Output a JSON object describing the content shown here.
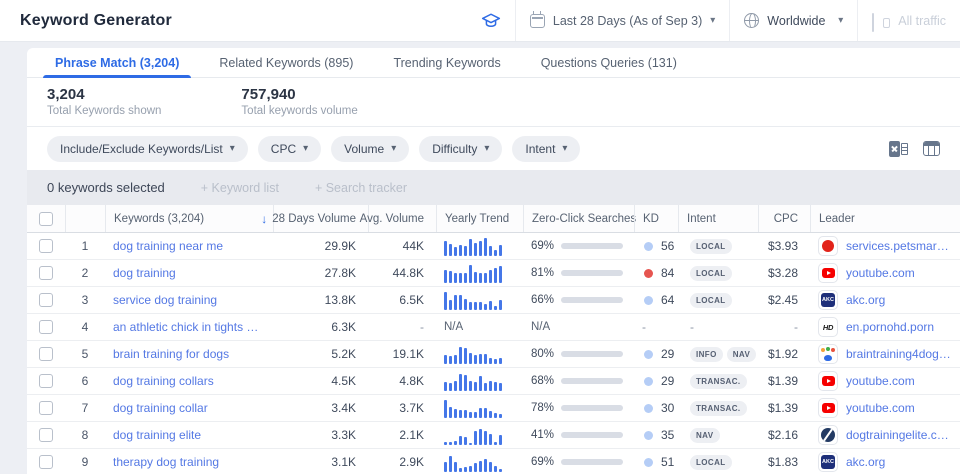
{
  "header": {
    "title": "Keyword Generator",
    "date_range": "Last 28 Days (As of Sep 3)",
    "region": "Worldwide",
    "traffic_label": "All traffic"
  },
  "tabs": [
    {
      "label": "Phrase Match (3,204)",
      "active": true
    },
    {
      "label": "Related Keywords (895)",
      "active": false
    },
    {
      "label": "Trending Keywords",
      "active": false
    },
    {
      "label": "Questions Queries (131)",
      "active": false
    }
  ],
  "stats": [
    {
      "value": "3,204",
      "label": "Total Keywords shown"
    },
    {
      "value": "757,940",
      "label": "Total keywords volume"
    }
  ],
  "filters": [
    "Include/Exclude Keywords/List",
    "CPC",
    "Volume",
    "Difficulty",
    "Intent"
  ],
  "toolbar_icons": [
    "excel-export-icon",
    "table-columns-icon"
  ],
  "selection": {
    "selected_text": "0 keywords selected",
    "keyword_list_label": "+ Keyword list",
    "search_tracker_label": "+ Search tracker"
  },
  "table": {
    "columns": [
      {
        "label": "Keywords (3,204)",
        "sorted": false,
        "align": "left"
      },
      {
        "label": "28 Days Volume",
        "sorted": true,
        "align": "right"
      },
      {
        "label": "Avg. Volume",
        "sorted": false,
        "align": "right"
      },
      {
        "label": "Yearly Trend",
        "sorted": false,
        "align": "left"
      },
      {
        "label": "Zero-Click Searches",
        "sorted": false,
        "align": "left"
      },
      {
        "label": "KD",
        "sorted": false,
        "align": "left"
      },
      {
        "label": "Intent",
        "sorted": false,
        "align": "left"
      },
      {
        "label": "CPC",
        "sorted": false,
        "align": "right"
      },
      {
        "label": "Leader",
        "sorted": false,
        "align": "left"
      }
    ],
    "rows": [
      {
        "num": "1",
        "keyword": "dog training near me",
        "volume_28d": "29.9K",
        "avg_volume": "44K",
        "trend": [
          80,
          65,
          45,
          60,
          55,
          92,
          70,
          80,
          95,
          55,
          30,
          60
        ],
        "zero_click": "69%",
        "zero_click_pct": 69,
        "kd": "56",
        "kd_color": "blue",
        "intents": [
          "LOCAL"
        ],
        "cpc": "$3.93",
        "leader": "services.petsmart…",
        "favicon": "petsmart"
      },
      {
        "num": "2",
        "keyword": "dog training",
        "volume_28d": "27.8K",
        "avg_volume": "44.8K",
        "trend": [
          70,
          62,
          50,
          50,
          55,
          95,
          60,
          50,
          52,
          70,
          80,
          88
        ],
        "zero_click": "81%",
        "zero_click_pct": 81,
        "kd": "84",
        "kd_color": "red",
        "intents": [
          "LOCAL"
        ],
        "cpc": "$3.28",
        "leader": "youtube.com",
        "favicon": "youtube"
      },
      {
        "num": "3",
        "keyword": "service dog training",
        "volume_28d": "13.8K",
        "avg_volume": "6.5K",
        "trend": [
          95,
          50,
          80,
          78,
          60,
          40,
          42,
          40,
          30,
          45,
          20,
          52
        ],
        "zero_click": "66%",
        "zero_click_pct": 66,
        "kd": "64",
        "kd_color": "blue",
        "intents": [
          "LOCAL"
        ],
        "cpc": "$2.45",
        "leader": "akc.org",
        "favicon": "akc"
      },
      {
        "num": "4",
        "keyword": "an athletic chick in tights got up d…",
        "volume_28d": "6.3K",
        "avg_volume": "-",
        "trend": null,
        "zero_click": "N/A",
        "zero_click_pct": null,
        "kd": "-",
        "kd_color": null,
        "intents": [],
        "cpc": "-",
        "leader": "en.pornohd.porn",
        "favicon": "hd"
      },
      {
        "num": "5",
        "keyword": "brain training for dogs",
        "volume_28d": "5.2K",
        "avg_volume": "19.1K",
        "trend": [
          48,
          40,
          45,
          90,
          85,
          60,
          45,
          55,
          50,
          30,
          28,
          30
        ],
        "zero_click": "80%",
        "zero_click_pct": 80,
        "kd": "29",
        "kd_color": "blue",
        "intents": [
          "INFO",
          "NAV"
        ],
        "cpc": "$1.92",
        "leader": "braintraining4dog…",
        "favicon": "paw"
      },
      {
        "num": "6",
        "keyword": "dog training collars",
        "volume_28d": "4.5K",
        "avg_volume": "4.8K",
        "trend": [
          48,
          42,
          52,
          90,
          85,
          50,
          45,
          80,
          40,
          55,
          45,
          40
        ],
        "zero_click": "68%",
        "zero_click_pct": 68,
        "kd": "29",
        "kd_color": "blue",
        "intents": [
          "TRANSAC."
        ],
        "cpc": "$1.39",
        "leader": "youtube.com",
        "favicon": "youtube"
      },
      {
        "num": "7",
        "keyword": "dog training collar",
        "volume_28d": "3.4K",
        "avg_volume": "3.7K",
        "trend": [
          95,
          60,
          45,
          40,
          40,
          30,
          30,
          55,
          50,
          35,
          28,
          20
        ],
        "zero_click": "78%",
        "zero_click_pct": 78,
        "kd": "30",
        "kd_color": "blue",
        "intents": [
          "TRANSAC."
        ],
        "cpc": "$1.39",
        "leader": "youtube.com",
        "favicon": "youtube"
      },
      {
        "num": "8",
        "keyword": "dog training elite",
        "volume_28d": "3.3K",
        "avg_volume": "2.1K",
        "trend": [
          15,
          15,
          20,
          45,
          40,
          10,
          75,
          82,
          75,
          60,
          15,
          50
        ],
        "zero_click": "41%",
        "zero_click_pct": 41,
        "kd": "35",
        "kd_color": "blue",
        "intents": [
          "NAV"
        ],
        "cpc": "$2.16",
        "leader": "dogtrainingelite.c…",
        "favicon": "elite"
      },
      {
        "num": "9",
        "keyword": "therapy dog training",
        "volume_28d": "3.1K",
        "avg_volume": "2.9K",
        "trend": [
          55,
          85,
          50,
          20,
          25,
          30,
          45,
          60,
          70,
          55,
          30,
          15
        ],
        "zero_click": "69%",
        "zero_click_pct": 69,
        "kd": "51",
        "kd_color": "blue",
        "intents": [
          "LOCAL"
        ],
        "cpc": "$1.83",
        "leader": "akc.org",
        "favicon": "akc"
      }
    ]
  },
  "colors": {
    "accent_blue": "#2e6be5",
    "link_blue": "#5478e4",
    "spark_bar": "#4577e8",
    "zero_click_fill": "#3e6ce0",
    "kd_easy_dot": "#b5cdf6",
    "kd_hard_dot": "#e65550",
    "selection_bar_bg": "#e8eaef",
    "page_bg": "#edeff4"
  }
}
